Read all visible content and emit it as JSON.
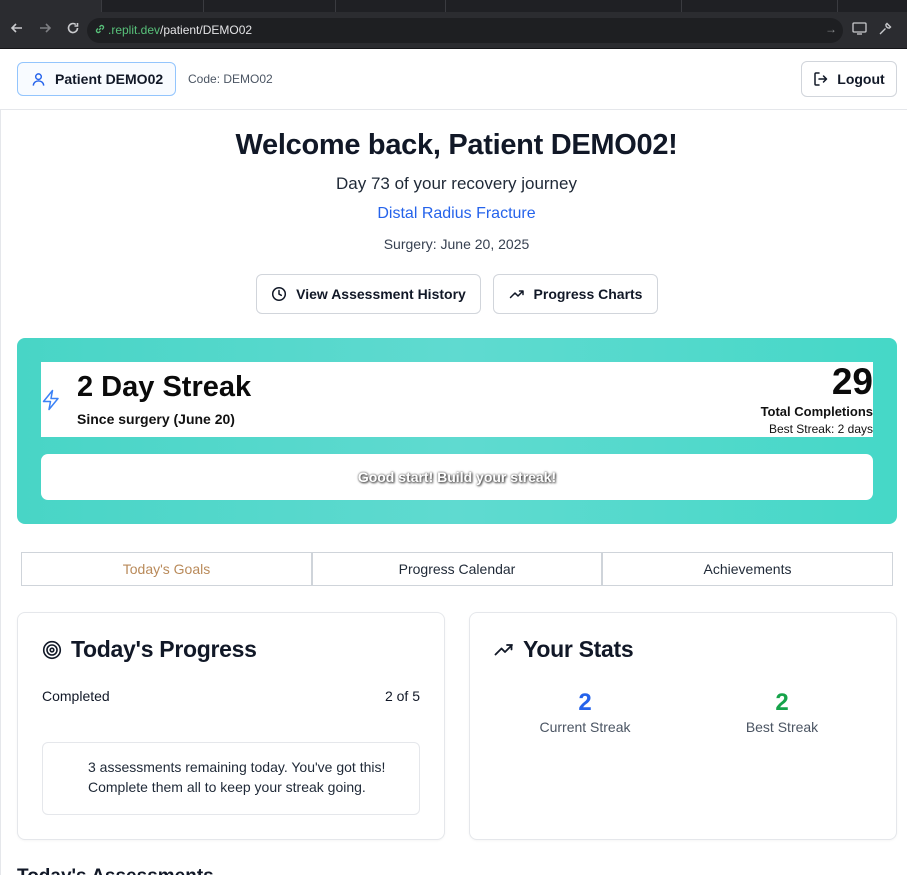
{
  "browser": {
    "url_host": ".replit.dev",
    "url_path": "/patient/DEMO02"
  },
  "header": {
    "patient_label": "Patient DEMO02",
    "code_text": "Code: DEMO02",
    "logout_label": "Logout"
  },
  "welcome": {
    "title": "Welcome back, Patient DEMO02!",
    "day_line": "Day 73 of your recovery journey",
    "injury": "Distal Radius Fracture",
    "surgery": "Surgery: June 20, 2025"
  },
  "actions": {
    "history_label": "View Assessment History",
    "charts_label": "Progress Charts"
  },
  "streak": {
    "title": "2 Day Streak",
    "subtitle": "Since surgery (June 20)",
    "total_number": "29",
    "total_label": "Total Completions",
    "best_label": "Best Streak: 2 days",
    "encouragement": "Good start! Build your streak!",
    "gradient_color": "#48d5c6"
  },
  "tabs": [
    {
      "label": "Today's Goals",
      "active": true
    },
    {
      "label": "Progress Calendar",
      "active": false
    },
    {
      "label": "Achievements",
      "active": false
    }
  ],
  "progress_card": {
    "title": "Today's Progress",
    "completed_label": "Completed",
    "completed_value": "2 of 5",
    "note": "3 assessments remaining today. You've got this! Complete them all to keep your streak going."
  },
  "stats_card": {
    "title": "Your Stats",
    "current_streak_value": "2",
    "current_streak_label": "Current Streak",
    "current_streak_color": "#2563eb",
    "best_streak_value": "2",
    "best_streak_label": "Best Streak",
    "best_streak_color": "#16a34a"
  },
  "next_section": {
    "heading": "Today's Assessments"
  }
}
